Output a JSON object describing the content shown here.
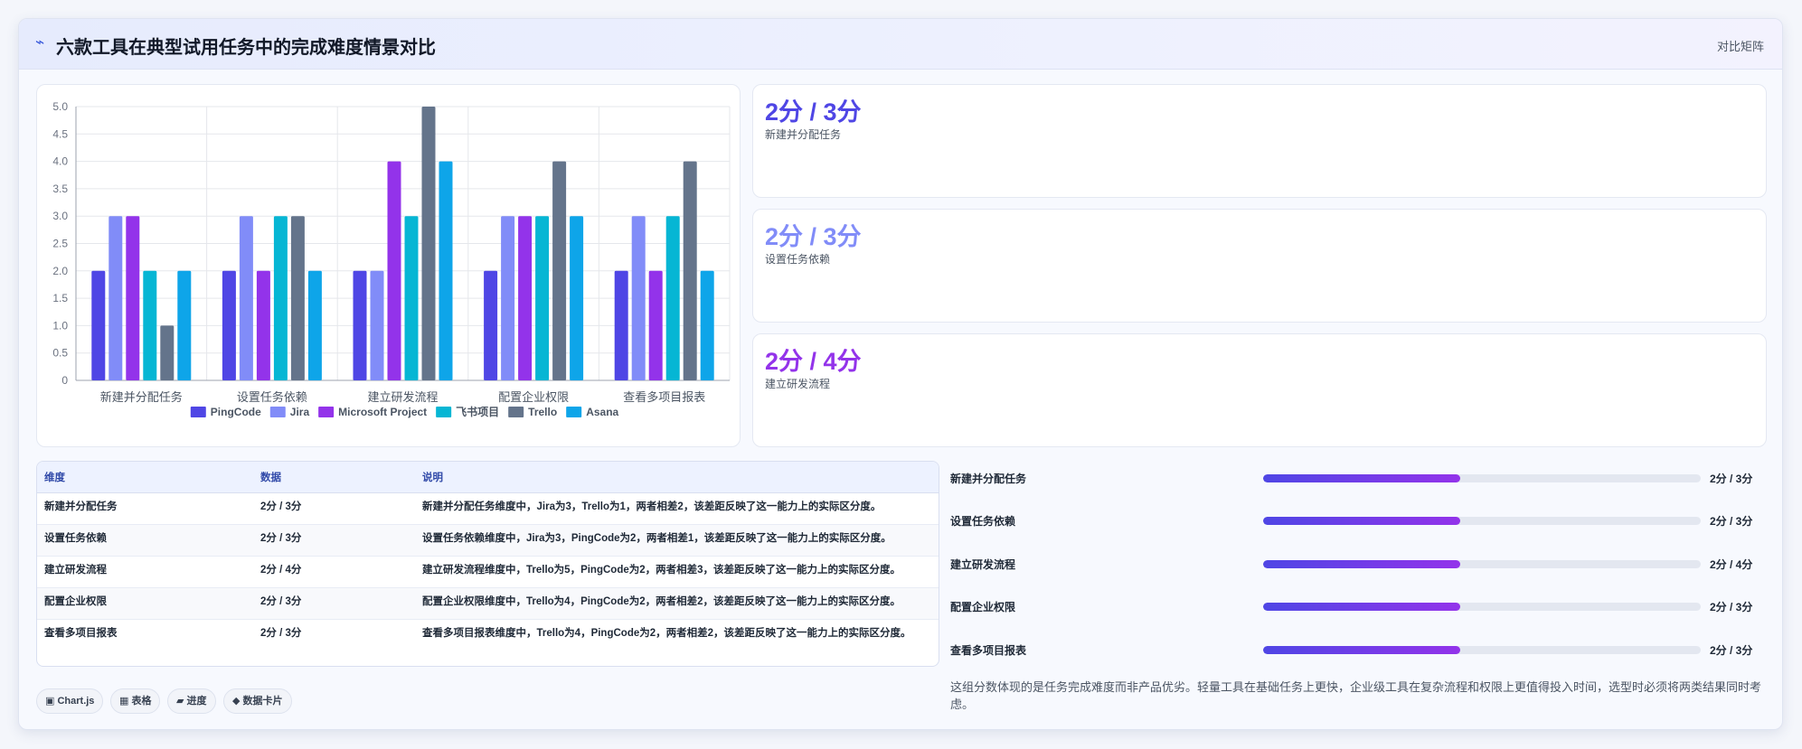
{
  "header": {
    "icon": "chart-spark-icon",
    "title": "六款工具在典型试用任务中的完成难度情景对比",
    "right_label": "对比矩阵"
  },
  "chart_data": {
    "type": "bar",
    "categories": [
      "新建并分配任务",
      "设置任务依赖",
      "建立研发流程",
      "配置企业权限",
      "查看多项目报表"
    ],
    "series": [
      {
        "name": "PingCode",
        "color": "#4f46e5",
        "values": [
          2,
          2,
          2,
          2,
          2
        ]
      },
      {
        "name": "Jira",
        "color": "#818cf8",
        "values": [
          3,
          3,
          2,
          3,
          3
        ]
      },
      {
        "name": "Microsoft Project",
        "color": "#9333ea",
        "values": [
          3,
          2,
          4,
          3,
          2
        ]
      },
      {
        "name": "飞书项目",
        "color": "#06b6d4",
        "values": [
          2,
          3,
          3,
          3,
          3
        ]
      },
      {
        "name": "Trello",
        "color": "#64748b",
        "values": [
          1,
          3,
          5,
          4,
          4
        ]
      },
      {
        "name": "Asana",
        "color": "#0ea5e9",
        "values": [
          2,
          2,
          4,
          3,
          2
        ]
      }
    ],
    "ylim": [
      0,
      5
    ],
    "yticks": [
      "0",
      "0.5",
      "1.0",
      "1.5",
      "2.0",
      "2.5",
      "3.0",
      "3.5",
      "4.0",
      "4.5",
      "5.0"
    ],
    "grid": true,
    "legend_position": "bottom"
  },
  "kpis": [
    {
      "value": "2分 / 3分",
      "label": "新建并分配任务",
      "color": "#4f46e5"
    },
    {
      "value": "2分 / 3分",
      "label": "设置任务依赖",
      "color": "#818cf8"
    },
    {
      "value": "2分 / 4分",
      "label": "建立研发流程",
      "color": "#9333ea"
    }
  ],
  "table": {
    "headers": [
      "维度",
      "数据",
      "说明"
    ],
    "rows": [
      [
        "新建并分配任务",
        "2分 / 3分",
        "新建并分配任务维度中，Jira为3，Trello为1，两者相差2，该差距反映了这一能力上的实际区分度。"
      ],
      [
        "设置任务依赖",
        "2分 / 3分",
        "设置任务依赖维度中，Jira为3，PingCode为2，两者相差1，该差距反映了这一能力上的实际区分度。"
      ],
      [
        "建立研发流程",
        "2分 / 4分",
        "建立研发流程维度中，Trello为5，PingCode为2，两者相差3，该差距反映了这一能力上的实际区分度。"
      ],
      [
        "配置企业权限",
        "2分 / 3分",
        "配置企业权限维度中，Trello为4，PingCode为2，两者相差2，该差距反映了这一能力上的实际区分度。"
      ],
      [
        "查看多项目报表",
        "2分 / 3分",
        "查看多项目报表维度中，Trello为4，PingCode为2，两者相差2，该差距反映了这一能力上的实际区分度。"
      ]
    ]
  },
  "chips": [
    {
      "icon": "chart-icon",
      "glyph": "▣",
      "label": "Chart.js"
    },
    {
      "icon": "table-icon",
      "glyph": "▦",
      "label": "表格"
    },
    {
      "icon": "progress-icon",
      "glyph": "▰",
      "label": "进度"
    },
    {
      "icon": "card-icon",
      "glyph": "◆",
      "label": "数据卡片"
    }
  ],
  "progress": [
    {
      "label": "新建并分配任务",
      "value": "2分 / 3分",
      "fraction": 0.45
    },
    {
      "label": "设置任务依赖",
      "value": "2分 / 3分",
      "fraction": 0.45
    },
    {
      "label": "建立研发流程",
      "value": "2分 / 4分",
      "fraction": 0.45
    },
    {
      "label": "配置企业权限",
      "value": "2分 / 3分",
      "fraction": 0.45
    },
    {
      "label": "查看多项目报表",
      "value": "2分 / 3分",
      "fraction": 0.45
    }
  ],
  "note": "这组分数体现的是任务完成难度而非产品优劣。轻量工具在基础任务上更快，企业级工具在复杂流程和权限上更值得投入时间，选型时必须将两类结果同时考虑。"
}
